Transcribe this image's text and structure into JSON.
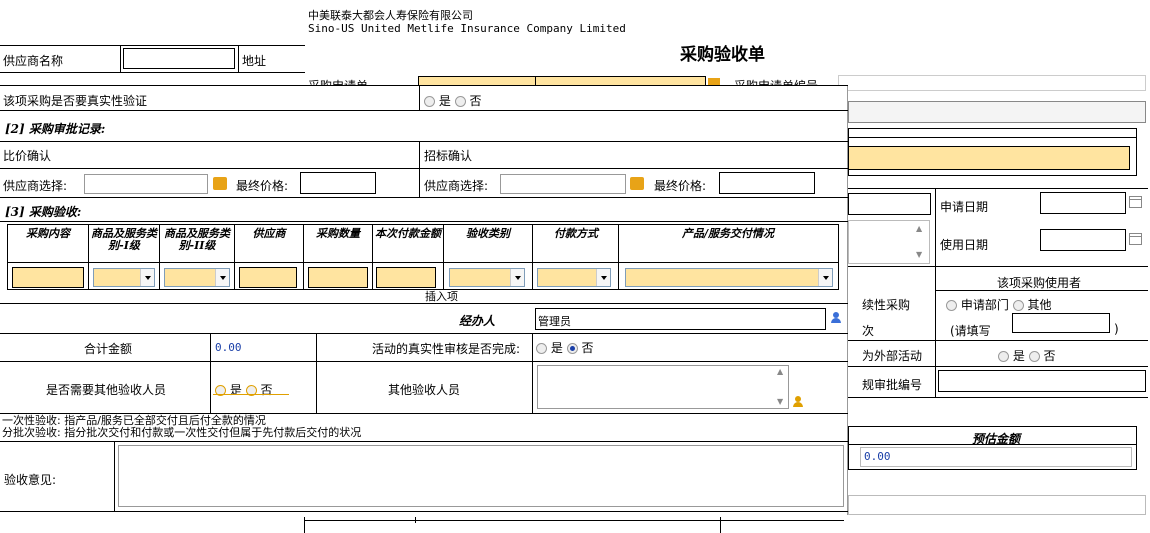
{
  "company": {
    "name_cn": "中美联泰大都会人寿保险有限公司",
    "name_en": "Sino-US United Metlife Insurance Company Limited"
  },
  "form_title": "采购验收单",
  "under": {
    "supplier_name_label": "供应商名称",
    "address_label": "地址",
    "purchase_request_label": "采购申请单",
    "purchase_request_no_label": "采购申请单编号",
    "apply_date_label": "申请日期",
    "use_date_label": "使用日期",
    "user_header": "该项采购使用者",
    "continuous_label": "续性采购",
    "apply_dept": "申请部门",
    "other": "其他",
    "once_label": "次",
    "fill_in_label": "(请填写",
    "fill_in_close": ")",
    "external_label": "为外部活动",
    "yes": "是",
    "no": "否",
    "approval_no_label": "规审批编号",
    "budget_header": "预估金额",
    "budget_value": "0.00"
  },
  "overlay": {
    "authenticity_label": "该项采购是否要真实性验证",
    "yes": "是",
    "no": "否",
    "section2": "[2] 采购审批记录:",
    "compare_label": "比价确认",
    "tender_label": "招标确认",
    "supplier_select_label": "供应商选择:",
    "final_price_label": "最终价格:",
    "section3": "[3] 采购验收:",
    "table_headers": [
      "采购内容",
      "商品及服务类别-I级",
      "商品及服务类别-II级",
      "供应商",
      "采购数量",
      "本次付款金额",
      "验收类别",
      "付款方式",
      "产品/服务交付情况"
    ],
    "insert_row": "插入项",
    "handler_label": "经办人",
    "handler_value": "管理员",
    "total_label": "合计金额",
    "total_value": "0.00",
    "activity_check_label": "活动的真实性审核是否完成:",
    "other_inspector_need_label": "是否需要其他验收人员",
    "other_inspector_label": "其他验收人员",
    "note1": "一次性验收: 指产品/服务已全部交付且后付全款的情况",
    "note2": "分批次验收: 指分批次交付和付款或一次性交付但属于先付款后交付的状况",
    "opinion_label": "验收意见:"
  },
  "colors": {
    "field_yellow": "#ffe4a0",
    "border": "#000000",
    "radio_selected": "#1a3fa8",
    "radio_orange": "#e0a000",
    "value_blue": "#1a3fa8"
  }
}
